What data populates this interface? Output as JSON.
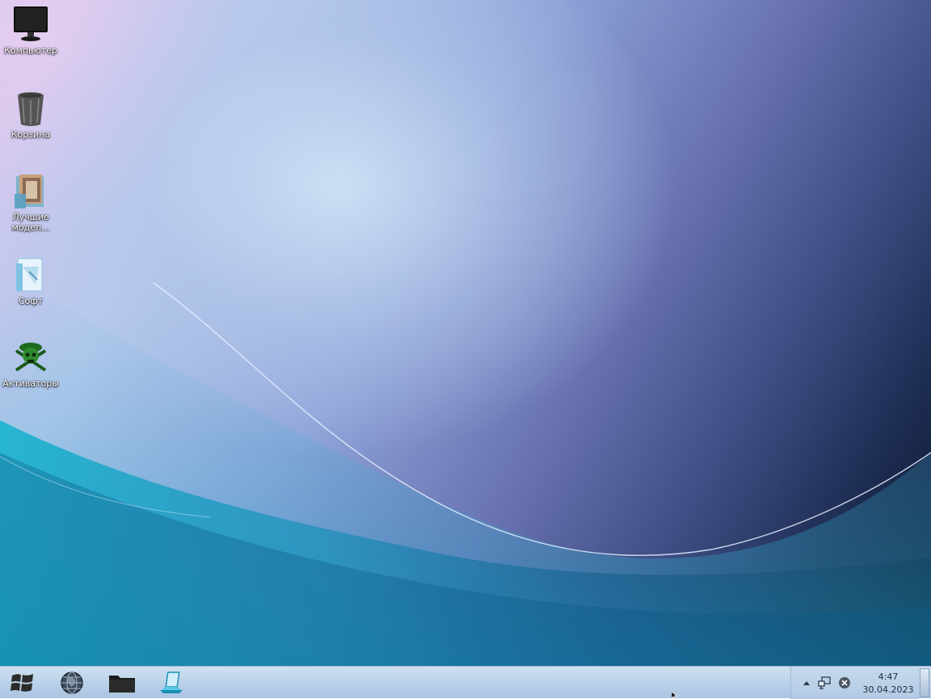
{
  "desktop": {
    "icons": [
      {
        "label": "Компьютер",
        "icon": "monitor-icon"
      },
      {
        "label": "Корзина",
        "icon": "recycle-bin-icon"
      },
      {
        "label": "Лучшие модел...",
        "icon": "photo-folder-icon"
      },
      {
        "label": "Софт",
        "icon": "folder-icon"
      },
      {
        "label": "Активаторы",
        "icon": "pirate-skull-icon"
      }
    ]
  },
  "taskbar": {
    "pinned": [
      {
        "icon": "start-windows-logo-icon"
      },
      {
        "icon": "globe-icon"
      },
      {
        "icon": "file-explorer-folder-icon"
      },
      {
        "icon": "laptop-stand-icon"
      }
    ],
    "tray": {
      "icons": [
        "show-hidden-icons-arrow-icon",
        "network-icon",
        "close-circle-icon"
      ],
      "time": "4:47",
      "date": "30.04.2023"
    }
  },
  "colors": {
    "taskbar_top": "#cfe0f0",
    "taskbar_bottom": "#aac4e2",
    "icon_text": "#ffffff"
  }
}
